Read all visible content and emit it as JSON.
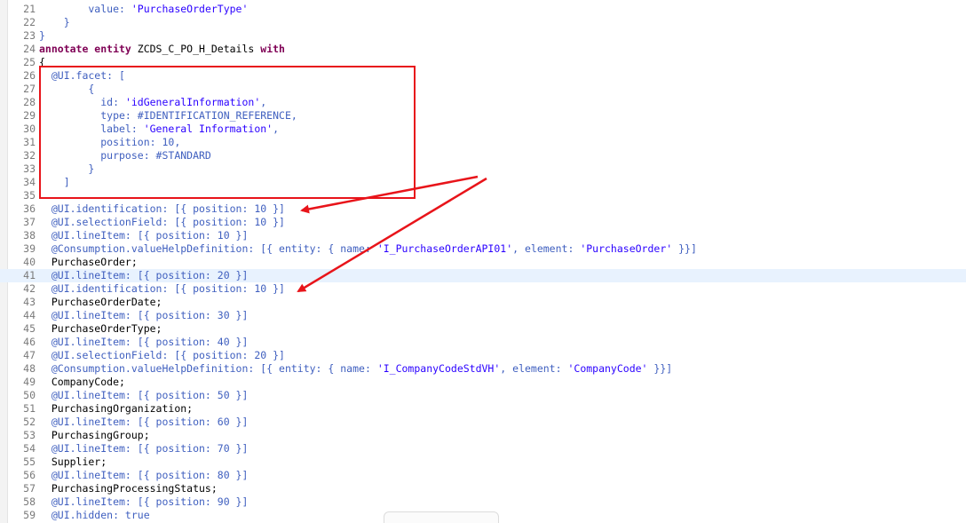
{
  "editor": {
    "current_line": "41",
    "colors": {
      "keyword": "#7f0055",
      "annotation": "#3f5fbf",
      "string": "#2a00ff",
      "highlight": "#e8141a",
      "current_line_bg": "#e8f2fe"
    },
    "lines": [
      {
        "num": "21",
        "segs": [
          {
            "t": "        value: ",
            "c": "ann"
          },
          {
            "t": "'PurchaseOrderType'",
            "c": "str"
          }
        ]
      },
      {
        "num": "22",
        "segs": [
          {
            "t": "    }",
            "c": "ann"
          }
        ]
      },
      {
        "num": "23",
        "segs": [
          {
            "t": "}",
            "c": "ann"
          }
        ]
      },
      {
        "num": "24",
        "segs": [
          {
            "t": "annotate entity",
            "c": "kw"
          },
          {
            "t": " ZCDS_C_PO_H_Details ",
            "c": "plain"
          },
          {
            "t": "with",
            "c": "kw"
          }
        ]
      },
      {
        "num": "25",
        "segs": [
          {
            "t": "{",
            "c": "plain"
          }
        ]
      },
      {
        "num": "26",
        "segs": [
          {
            "t": "  @UI.facet: [",
            "c": "ann"
          }
        ]
      },
      {
        "num": "27",
        "segs": [
          {
            "t": "        {",
            "c": "ann"
          }
        ]
      },
      {
        "num": "28",
        "segs": [
          {
            "t": "          id: ",
            "c": "ann"
          },
          {
            "t": "'idGeneralInformation'",
            "c": "str"
          },
          {
            "t": ",",
            "c": "ann"
          }
        ]
      },
      {
        "num": "29",
        "segs": [
          {
            "t": "          type: #IDENTIFICATION_REFERENCE,",
            "c": "ann"
          }
        ]
      },
      {
        "num": "30",
        "segs": [
          {
            "t": "          label: ",
            "c": "ann"
          },
          {
            "t": "'General Information'",
            "c": "str"
          },
          {
            "t": ",",
            "c": "ann"
          }
        ]
      },
      {
        "num": "31",
        "segs": [
          {
            "t": "          position: 10,",
            "c": "ann"
          }
        ]
      },
      {
        "num": "32",
        "segs": [
          {
            "t": "          purpose: #STANDARD",
            "c": "ann"
          }
        ]
      },
      {
        "num": "33",
        "segs": [
          {
            "t": "        }",
            "c": "ann"
          }
        ]
      },
      {
        "num": "34",
        "segs": [
          {
            "t": "    ]",
            "c": "ann"
          }
        ]
      },
      {
        "num": "35",
        "segs": [
          {
            "t": "",
            "c": "plain"
          }
        ]
      },
      {
        "num": "36",
        "segs": [
          {
            "t": "  @UI.identification: [{ position: 10 }]",
            "c": "ann"
          }
        ]
      },
      {
        "num": "37",
        "segs": [
          {
            "t": "  @UI.selectionField: [{ position: 10 }]",
            "c": "ann"
          }
        ]
      },
      {
        "num": "38",
        "segs": [
          {
            "t": "  @UI.lineItem: [{ position: 10 }]",
            "c": "ann"
          }
        ]
      },
      {
        "num": "39",
        "segs": [
          {
            "t": "  @Consumption.valueHelpDefinition: [{ entity: { name: ",
            "c": "ann"
          },
          {
            "t": "'I_PurchaseOrderAPI01'",
            "c": "str"
          },
          {
            "t": ", element: ",
            "c": "ann"
          },
          {
            "t": "'PurchaseOrder'",
            "c": "str"
          },
          {
            "t": " }}]",
            "c": "ann"
          }
        ]
      },
      {
        "num": "40",
        "segs": [
          {
            "t": "  PurchaseOrder;",
            "c": "plain"
          }
        ]
      },
      {
        "num": "41",
        "segs": [
          {
            "t": "  @UI.lineItem: [{ position: 20 }]",
            "c": "ann"
          }
        ]
      },
      {
        "num": "42",
        "segs": [
          {
            "t": "  @UI.identification: [{ position: 10 }]",
            "c": "ann"
          }
        ]
      },
      {
        "num": "43",
        "segs": [
          {
            "t": "  PurchaseOrderDate;",
            "c": "plain"
          }
        ]
      },
      {
        "num": "44",
        "segs": [
          {
            "t": "  @UI.lineItem: [{ position: 30 }]",
            "c": "ann"
          }
        ]
      },
      {
        "num": "45",
        "segs": [
          {
            "t": "  PurchaseOrderType;",
            "c": "plain"
          }
        ]
      },
      {
        "num": "46",
        "segs": [
          {
            "t": "  @UI.lineItem: [{ position: 40 }]",
            "c": "ann"
          }
        ]
      },
      {
        "num": "47",
        "segs": [
          {
            "t": "  @UI.selectionField: [{ position: 20 }]",
            "c": "ann"
          }
        ]
      },
      {
        "num": "48",
        "segs": [
          {
            "t": "  @Consumption.valueHelpDefinition: [{ entity: { name: ",
            "c": "ann"
          },
          {
            "t": "'I_CompanyCodeStdVH'",
            "c": "str"
          },
          {
            "t": ", element: ",
            "c": "ann"
          },
          {
            "t": "'CompanyCode'",
            "c": "str"
          },
          {
            "t": " }}]",
            "c": "ann"
          }
        ]
      },
      {
        "num": "49",
        "segs": [
          {
            "t": "  CompanyCode;",
            "c": "plain"
          }
        ]
      },
      {
        "num": "50",
        "segs": [
          {
            "t": "  @UI.lineItem: [{ position: 50 }]",
            "c": "ann"
          }
        ]
      },
      {
        "num": "51",
        "segs": [
          {
            "t": "  PurchasingOrganization;",
            "c": "plain"
          }
        ]
      },
      {
        "num": "52",
        "segs": [
          {
            "t": "  @UI.lineItem: [{ position: 60 }]",
            "c": "ann"
          }
        ]
      },
      {
        "num": "53",
        "segs": [
          {
            "t": "  PurchasingGroup;",
            "c": "plain"
          }
        ]
      },
      {
        "num": "54",
        "segs": [
          {
            "t": "  @UI.lineItem: [{ position: 70 }]",
            "c": "ann"
          }
        ]
      },
      {
        "num": "55",
        "segs": [
          {
            "t": "  Supplier;",
            "c": "plain"
          }
        ]
      },
      {
        "num": "56",
        "segs": [
          {
            "t": "  @UI.lineItem: [{ position: 80 }]",
            "c": "ann"
          }
        ]
      },
      {
        "num": "57",
        "segs": [
          {
            "t": "  PurchasingProcessingStatus;",
            "c": "plain"
          }
        ]
      },
      {
        "num": "58",
        "segs": [
          {
            "t": "  @UI.lineItem: [{ position: 90 }]",
            "c": "ann"
          }
        ]
      },
      {
        "num": "59",
        "segs": [
          {
            "t": "  @UI.hidden: true",
            "c": "ann"
          }
        ]
      }
    ]
  }
}
